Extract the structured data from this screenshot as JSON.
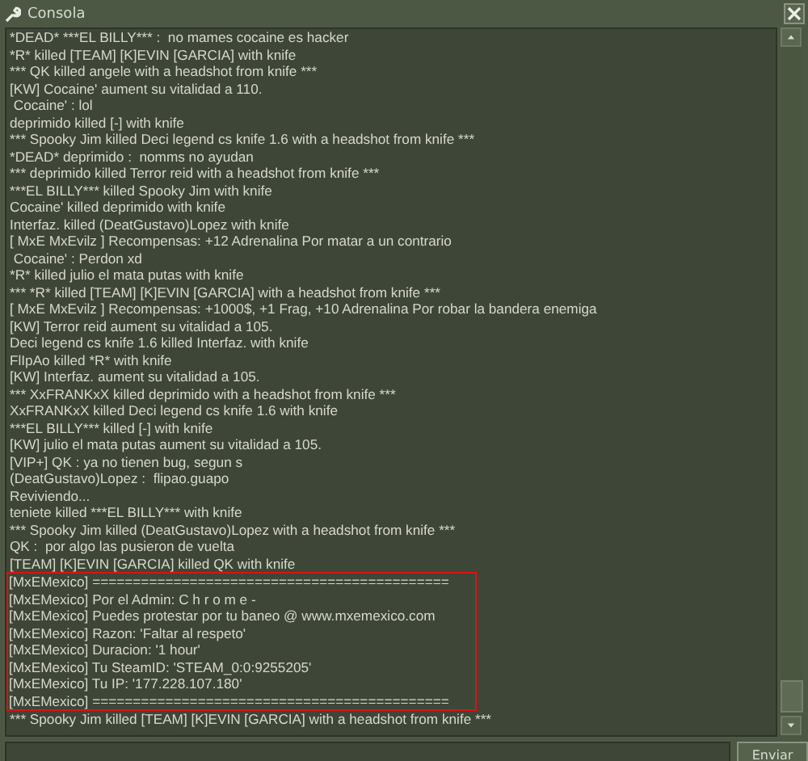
{
  "window": {
    "title": "Consola"
  },
  "log": [
    "*DEAD* ***EL BILLY*** :  no mames cocaine es hacker",
    "*R* killed [TEAM] [K]EVIN [GARCIA] with knife",
    "*** QK killed angele with a headshot from knife ***",
    "[KW] Cocaine' aument su vitalidad a 110.",
    " Cocaine' : lol",
    "deprimido killed [-] with knife",
    "*** Spooky Jim killed Deci legend cs knife 1.6 with a headshot from knife ***",
    "*DEAD* deprimido :  nomms no ayudan",
    "*** deprimido killed Terror reid with a headshot from knife ***",
    "***EL BILLY*** killed Spooky Jim with knife",
    "Cocaine' killed deprimido with knife",
    "Interfaz. killed (DeatGustavo)Lopez with knife",
    "[ MxE MxEvilz ] Recompensas: +12 Adrenalina Por matar a un contrario",
    " Cocaine' : Perdon xd",
    "*R* killed julio el mata putas with knife",
    "*** *R* killed [TEAM] [K]EVIN [GARCIA] with a headshot from knife ***",
    "[ MxE MxEvilz ] Recompensas: +1000$, +1 Frag, +10 Adrenalina Por robar la bandera enemiga",
    "[KW] Terror reid aument su vitalidad a 105.",
    "Deci legend cs knife 1.6 killed Interfaz. with knife",
    "FlIpAo killed *R* with knife",
    "[KW] Interfaz. aument su vitalidad a 105.",
    "*** XxFRANKxX killed deprimido with a headshot from knife ***",
    "XxFRANKxX killed Deci legend cs knife 1.6 with knife",
    "***EL BILLY*** killed [-] with knife",
    "[KW] julio el mata putas aument su vitalidad a 105.",
    "[VIP+] QK : ya no tienen bug, segun s",
    "(DeatGustavo)Lopez :  flipao.guapo",
    "Reviviendo...",
    "teniete killed ***EL BILLY*** with knife",
    "*** Spooky Jim killed (DeatGustavo)Lopez with a headshot from knife ***",
    "QK :  por algo las pusieron de vuelta",
    "[TEAM] [K]EVIN [GARCIA] killed QK with knife"
  ],
  "highlighted_log": [
    "[MxEMexico] ============================================",
    "[MxEMexico] Por el Admin: C h r o m e -",
    "[MxEMexico] Puedes protestar por tu baneo @ www.mxemexico.com",
    "[MxEMexico] Razon: 'Faltar al respeto'",
    "[MxEMexico] Duracion: '1 hour'",
    "[MxEMexico] Tu SteamID: 'STEAM_0:0:9255205'",
    "[MxEMexico] Tu IP: '177.228.107.180'",
    "[MxEMexico] ============================================"
  ],
  "log_after": [
    "*** Spooky Jim killed [TEAM] [K]EVIN [GARCIA] with a headshot from knife ***"
  ],
  "submit_button": {
    "label": "Enviar"
  }
}
